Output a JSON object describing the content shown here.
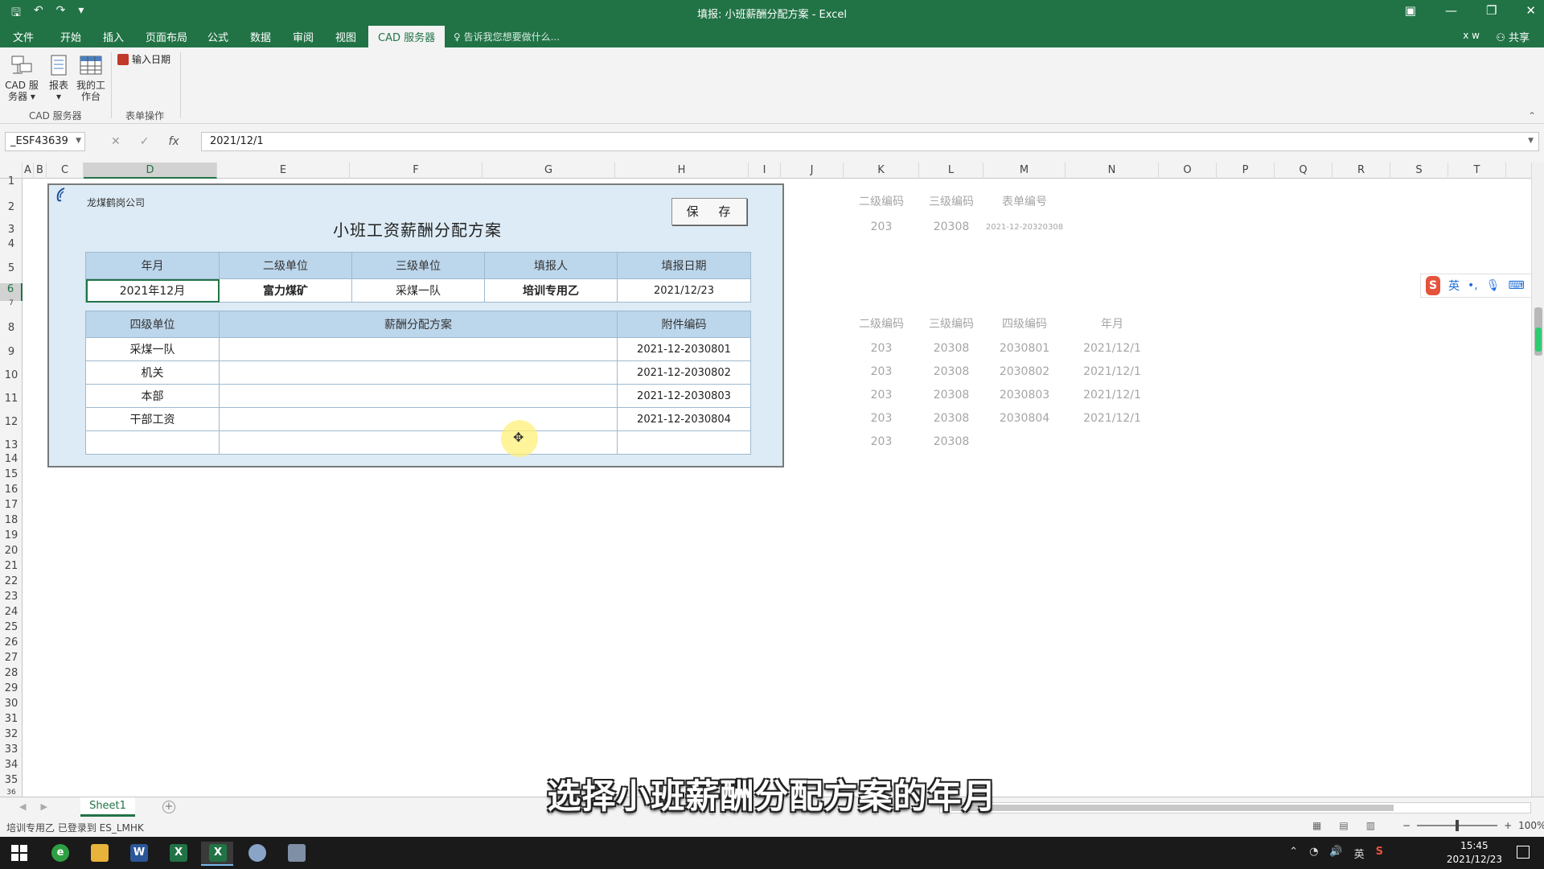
{
  "app": {
    "window_title": "填报: 小班薪酬分配方案 - Excel",
    "user": "x w",
    "share": "共享"
  },
  "ribbon_tabs": [
    "文件",
    "开始",
    "插入",
    "页面布局",
    "公式",
    "数据",
    "审阅",
    "视图",
    "CAD 服务器"
  ],
  "active_tab": "CAD 服务器",
  "tell_me": "告诉我您想要做什么...",
  "ribbon": {
    "cad_server_btn": "CAD 服务器",
    "report_btn": "报表",
    "workbench_btn": "我的工作台",
    "group1_label": "CAD 服务器",
    "input_date_btn": "输入日期",
    "group2_label": "表单操作"
  },
  "formula_bar": {
    "name_box": "_ESF43639",
    "value": "2021/12/1"
  },
  "columns": [
    "A",
    "B",
    "C",
    "D",
    "E",
    "F",
    "G",
    "H",
    "I",
    "J",
    "K",
    "L",
    "M",
    "N",
    "O",
    "P",
    "Q",
    "R",
    "S",
    "T"
  ],
  "rows": [
    "1",
    "2",
    "3",
    "4",
    "5",
    "6",
    "7",
    "8",
    "9",
    "10",
    "11",
    "12",
    "13",
    "14",
    "15",
    "16",
    "17",
    "18",
    "19",
    "20",
    "21",
    "22",
    "23",
    "24",
    "25",
    "26",
    "27",
    "28",
    "29",
    "30",
    "31",
    "32",
    "33",
    "34",
    "35",
    "36"
  ],
  "form": {
    "company": "龙煤鹤岗公司",
    "title": "小班工资薪酬分配方案",
    "save_button": "保 存",
    "header_table": {
      "headers": [
        "年月",
        "二级单位",
        "三级单位",
        "填报人",
        "填报日期"
      ],
      "values": [
        "2021年12月",
        "富力煤矿",
        "采煤一队",
        "培训专用乙",
        "2021/12/23"
      ]
    },
    "detail_table": {
      "headers": [
        "四级单位",
        "薪酬分配方案",
        "附件编码"
      ],
      "rows": [
        [
          "采煤一队",
          "",
          "2021-12-2030801"
        ],
        [
          "机关",
          "",
          "2021-12-2030802"
        ],
        [
          "本部",
          "",
          "2021-12-2030803"
        ],
        [
          "干部工资",
          "",
          "2021-12-2030804"
        ],
        [
          "",
          "",
          ""
        ]
      ]
    }
  },
  "side_block1": {
    "headers": [
      "二级编码",
      "三级编码",
      "表单编号"
    ],
    "values": [
      "203",
      "20308",
      "2021-12-20320308"
    ]
  },
  "side_block2": {
    "headers": [
      "二级编码",
      "三级编码",
      "四级编码",
      "年月"
    ],
    "rows": [
      [
        "203",
        "20308",
        "2030801",
        "2021/12/1"
      ],
      [
        "203",
        "20308",
        "2030802",
        "2021/12/1"
      ],
      [
        "203",
        "20308",
        "2030803",
        "2021/12/1"
      ],
      [
        "203",
        "20308",
        "2030804",
        "2021/12/1"
      ],
      [
        "203",
        "20308",
        "",
        ""
      ]
    ]
  },
  "ime_bar": {
    "logo": "S",
    "mode": "英"
  },
  "sheet_tab": "Sheet1",
  "status": {
    "text": "培训专用乙 已登录到 ES_LMHK",
    "zoom": "100%"
  },
  "caption": "选择小班薪酬分配方案的年月",
  "taskbar": {
    "tray_ime": "英",
    "time": "15:45",
    "date": "2021/12/23"
  },
  "colors": {
    "excel_green": "#217346",
    "form_bg": "#dcebf5",
    "header_blue": "#bcd6eb"
  }
}
